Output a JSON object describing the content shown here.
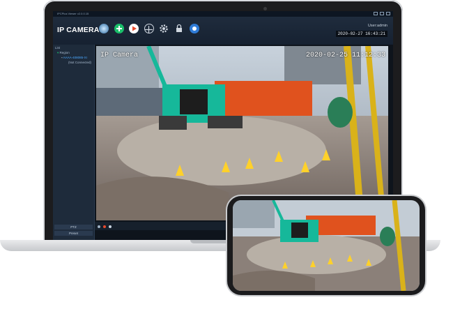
{
  "app": {
    "window_title": "IPCPlus Viewer v2.0.0.15",
    "brand": "IP CAMERA",
    "user": "User:admin",
    "datetime": "2020-02-27 16:43:21"
  },
  "toolbar": {
    "icons": [
      "live-view-icon",
      "add-icon",
      "playback-icon",
      "ptz-icon",
      "settings-icon",
      "lock-icon",
      "info-icon"
    ]
  },
  "sidebar": {
    "header": "List",
    "tree": [
      {
        "label": "Region"
      },
      {
        "label": "AAAA-408085-XI"
      },
      {
        "label": "(Not Connected)"
      }
    ],
    "buttons": [
      "PTZ",
      "Preset"
    ]
  },
  "feed": {
    "osd_name": "IP Camera",
    "osd_time": "2020-02-25 11:12:33"
  },
  "colors": {
    "accent_green": "#1bbf6a",
    "header_bg": "#1f2c3d",
    "excavator": "#16b89a",
    "wall_orange": "#e0521e",
    "cone_yellow": "#ffd12a"
  }
}
